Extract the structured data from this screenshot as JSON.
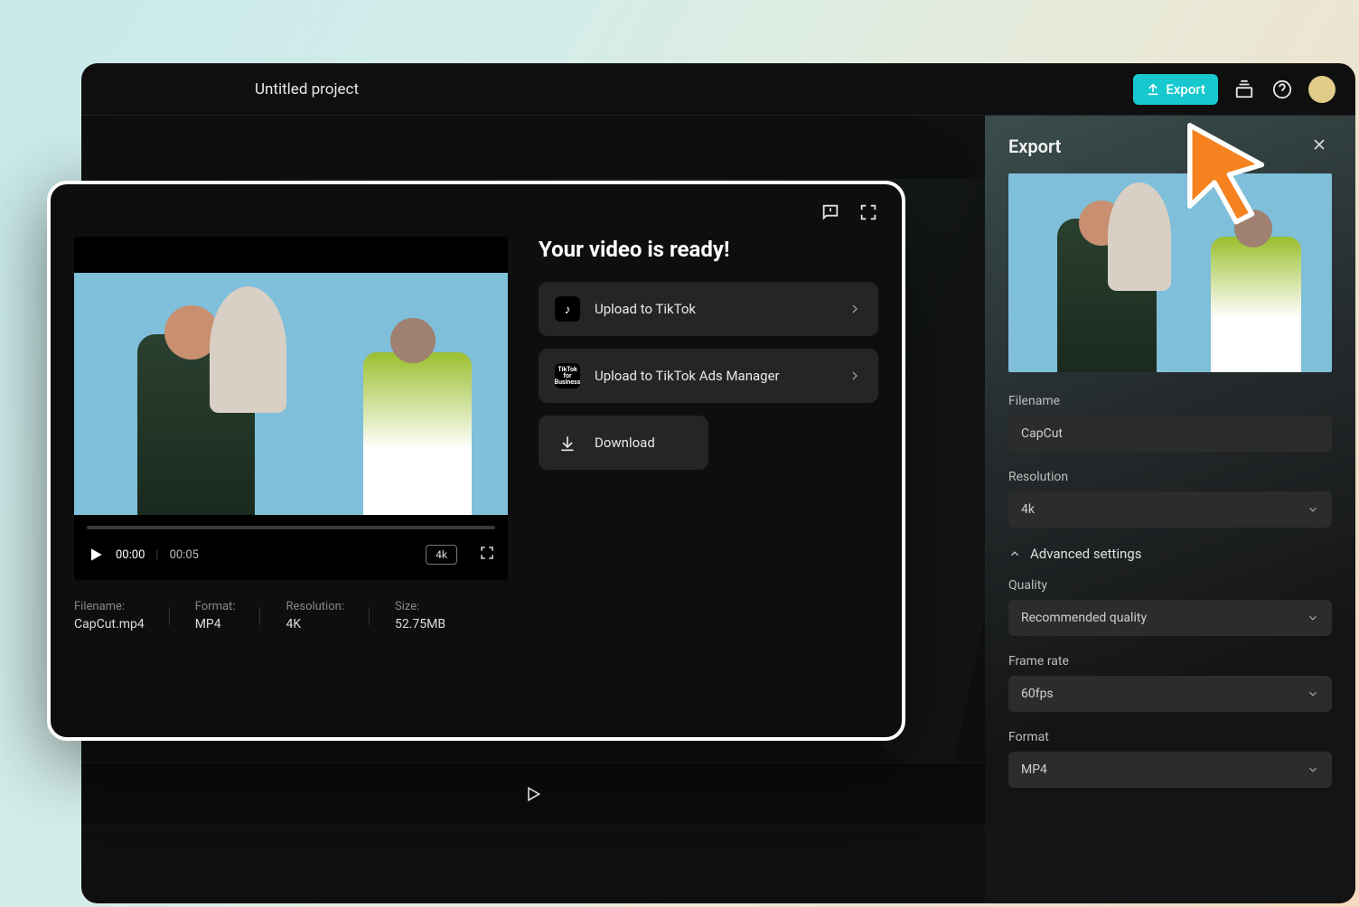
{
  "topbar": {
    "title": "Untitled project",
    "export_label": "Export"
  },
  "export_panel": {
    "title": "Export",
    "filename_label": "Filename",
    "filename_value": "CapCut",
    "resolution_label": "Resolution",
    "resolution_value": "4k",
    "advanced_label": "Advanced settings",
    "quality_label": "Quality",
    "quality_value": "Recommended quality",
    "framerate_label": "Frame rate",
    "framerate_value": "60fps",
    "format_label": "Format",
    "format_value": "MP4"
  },
  "ready_modal": {
    "title": "Your video is ready!",
    "upload_tiktok": "Upload to TikTok",
    "upload_ads": "Upload to TikTok Ads Manager",
    "download": "Download",
    "time_current": "00:00",
    "time_total": "00:05",
    "badge": "4k",
    "meta": {
      "filename_label": "Filename:",
      "filename_value": "CapCut.mp4",
      "format_label": "Format:",
      "format_value": "MP4",
      "resolution_label": "Resolution:",
      "resolution_value": "4K",
      "size_label": "Size:",
      "size_value": "52.75MB"
    }
  }
}
